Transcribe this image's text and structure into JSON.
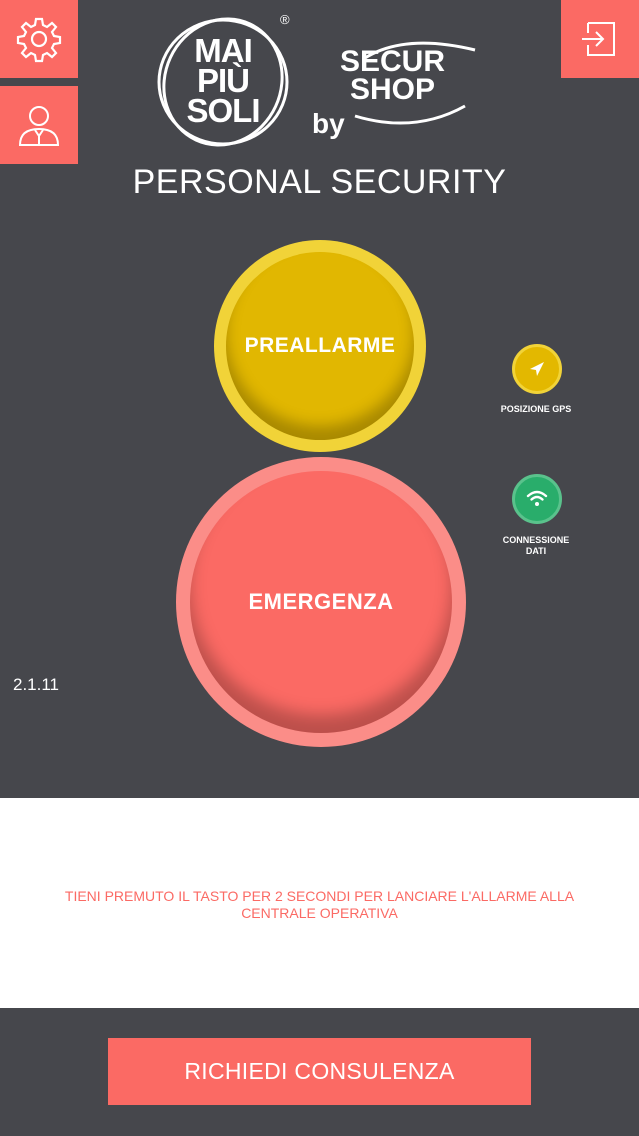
{
  "header": {
    "brand_line1": "MAI",
    "brand_line2": "PIÙ",
    "brand_line3": "SOLI",
    "registered": "®",
    "by": "by",
    "partner_line1": "SECUR",
    "partner_line2": "SHOP",
    "title": "PERSONAL SECURITY",
    "icons": [
      "gear-icon",
      "user-icon",
      "logout-icon"
    ]
  },
  "buttons": {
    "prealarm": "PREALLARME",
    "emergency": "EMERGENZA",
    "consult": "RICHIEDI CONSULENZA"
  },
  "status": {
    "gps_label": "POSIZIONE GPS",
    "data_label_line1": "CONNESSIONE",
    "data_label_line2": "DATI"
  },
  "version": "2.1.11",
  "info": {
    "line1": "TIENI PREMUTO IL TASTO PER 2 SECONDI  PER LANCIARE L'ALLARME ALLA",
    "line2": "CENTRALE OPERATIVA"
  },
  "colors": {
    "background": "#46474c",
    "accent": "#fb6a64",
    "prealarm": "#e1b701",
    "gps": "#e3b800",
    "data_ok": "#29ad6b"
  }
}
